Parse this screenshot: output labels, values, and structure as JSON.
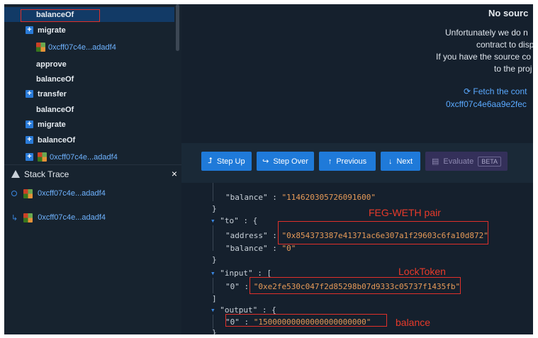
{
  "tree": {
    "items": [
      {
        "label": "balanceOf",
        "kind": "fn",
        "selected": true
      },
      {
        "label": "migrate",
        "kind": "expand"
      },
      {
        "label": "0xcff07c4e...adadf4",
        "kind": "addr"
      },
      {
        "label": "approve",
        "kind": "fn"
      },
      {
        "label": "balanceOf",
        "kind": "fn"
      },
      {
        "label": "transfer",
        "kind": "expand"
      },
      {
        "label": "balanceOf",
        "kind": "fn"
      },
      {
        "label": "migrate",
        "kind": "expand"
      },
      {
        "label": "balanceOf",
        "kind": "expand"
      },
      {
        "label": "0xcff07c4e...adadf4",
        "kind": "expand-addr"
      }
    ]
  },
  "stack_trace": {
    "title": "Stack Trace",
    "close": "×",
    "rows": [
      {
        "label": "0xcff07c4e...adadf4"
      },
      {
        "label": "0xcff07c4e...adadf4"
      }
    ]
  },
  "source": {
    "title": "No sourc",
    "lines": [
      "Unfortunately we do n",
      "contract to disp",
      "If you have the source co",
      "to the proj"
    ],
    "fetch": "Fetch the cont",
    "address": "0xcff07c4e6aa9e2fec"
  },
  "toolbar": {
    "step_up": "Step Up",
    "step_over": "Step Over",
    "previous": "Previous",
    "next": "Next",
    "evaluate": "Evaluate",
    "beta": "BETA"
  },
  "code": {
    "balance_key": "\"balance\"",
    "balance_val": "\"114620305726091600\"",
    "to_key": "\"to\"",
    "address_key": "\"address\"",
    "address_val": "\"0x854373387e41371ac6e307a1f29603c6fa10d872\"",
    "to_balance_key": "\"balance\"",
    "to_balance_val": "\"0\"",
    "input_key": "\"input\"",
    "input_0_key": "\"0\"",
    "input_0_val": "\"0xe2fe530c047f2d85298b07d9333c05737f1435fb\"",
    "output_key": "\"output\"",
    "output_0_key": "\"0\"",
    "output_0_val": "\"15000000000000000000000\""
  },
  "annotations": {
    "pair": "FEG-WETH pair",
    "lock_token": "LockToken",
    "balance": "balance"
  },
  "colors": {
    "accent": "#1f7ad9",
    "annotation": "#e83a2a",
    "string": "#e69a58"
  }
}
